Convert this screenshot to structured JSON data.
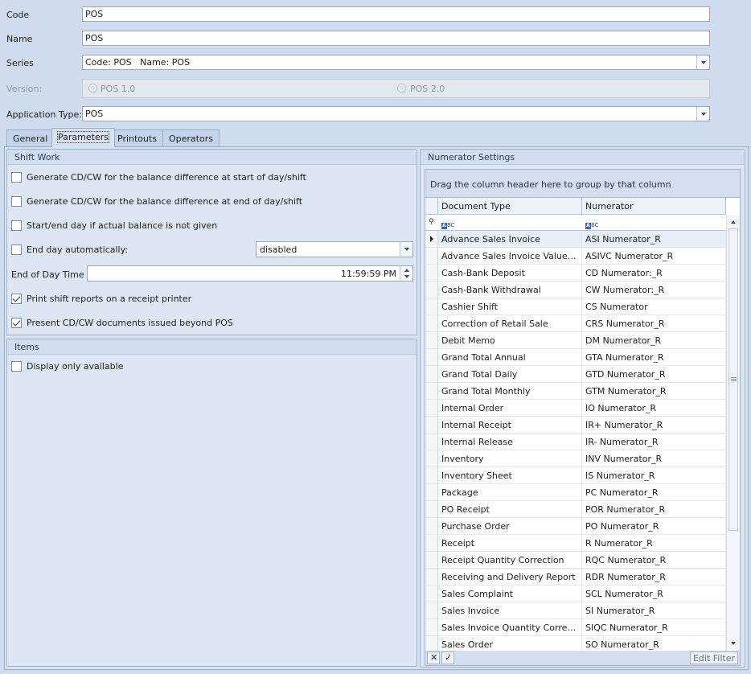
{
  "form": {
    "code_label": "Code",
    "code_value": "POS",
    "name_label": "Name",
    "name_value": "POS",
    "series_label": "Series",
    "series_value": "Code: POS   Name: POS",
    "version_label": "Version:",
    "version_options": [
      "POS 1.0",
      "POS 2.0"
    ],
    "apptype_label": "Application Type:",
    "apptype_value": "POS"
  },
  "tabs": [
    "General",
    "Parameters",
    "Printouts",
    "Operators"
  ],
  "active_tab": "Parameters",
  "shift_work": {
    "title": "Shift Work",
    "options": [
      {
        "label": "Generate CD/CW for the balance difference at start of day/shift",
        "checked": false
      },
      {
        "label": "Generate CD/CW for the balance difference at end of day/shift",
        "checked": false
      },
      {
        "label": "Start/end day if actual balance is not given",
        "checked": false
      },
      {
        "label": "End day automatically:",
        "checked": false
      }
    ],
    "auto_end_value": "disabled",
    "end_time_label": "End of Day Time",
    "end_time_value": "11:59:59 PM",
    "options2": [
      {
        "label": "Print shift reports on a receipt printer",
        "checked": true
      },
      {
        "label": "Present CD/CW documents issued beyond POS",
        "checked": true
      }
    ]
  },
  "items": {
    "title": "Items",
    "options": [
      {
        "label": "Display only available",
        "checked": false
      }
    ]
  },
  "numerator": {
    "title": "Numerator Settings",
    "group_hint": "Drag the column header here to group by that column",
    "columns": [
      "Document Type",
      "Numerator"
    ],
    "filter_icon_text": "BC",
    "rows": [
      [
        "Advance Sales Invoice",
        "ASI Numerator_R"
      ],
      [
        "Advance Sales Invoice Value Co...",
        "ASIVC Numerator_R"
      ],
      [
        "Cash-Bank Deposit",
        "CD Numerator:_R"
      ],
      [
        "Cash-Bank Withdrawal",
        "CW Numerator:_R"
      ],
      [
        "Cashier Shift",
        "CS Numerator"
      ],
      [
        "Correction of Retail Sale",
        "CRS Numerator_R"
      ],
      [
        "Debit Memo",
        "DM Numerator_R"
      ],
      [
        "Grand Total Annual",
        "GTA Numerator_R"
      ],
      [
        "Grand Total Daily",
        "GTD Numerator_R"
      ],
      [
        "Grand Total Monthly",
        "GTM Numerator_R"
      ],
      [
        "Internal Order",
        "IO Numerator_R"
      ],
      [
        "Internal Receipt",
        "IR+ Numerator_R"
      ],
      [
        "Internal Release",
        "IR- Numerator_R"
      ],
      [
        "Inventory",
        "INV Numerator_R"
      ],
      [
        "Inventory Sheet",
        "IS Numerator_R"
      ],
      [
        "Package",
        "PC Numerator_R"
      ],
      [
        "PO Receipt",
        "POR Numerator_R"
      ],
      [
        "Purchase Order",
        "PO Numerator_R"
      ],
      [
        "Receipt",
        "R Numerator_R"
      ],
      [
        "Receipt Quantity Correction",
        "RQC Numerator_R"
      ],
      [
        "Receiving and Delivery Report",
        "RDR Numerator_R"
      ],
      [
        "Sales Complaint",
        "SCL Numerator_R"
      ],
      [
        "Sales Invoice",
        "SI Numerator_R"
      ],
      [
        "Sales Invoice Quantity Correction",
        "SIQC Numerator_R"
      ],
      [
        "Sales Order",
        "SO Numerator_R"
      ]
    ],
    "edit_filter": "Edit Filter"
  }
}
